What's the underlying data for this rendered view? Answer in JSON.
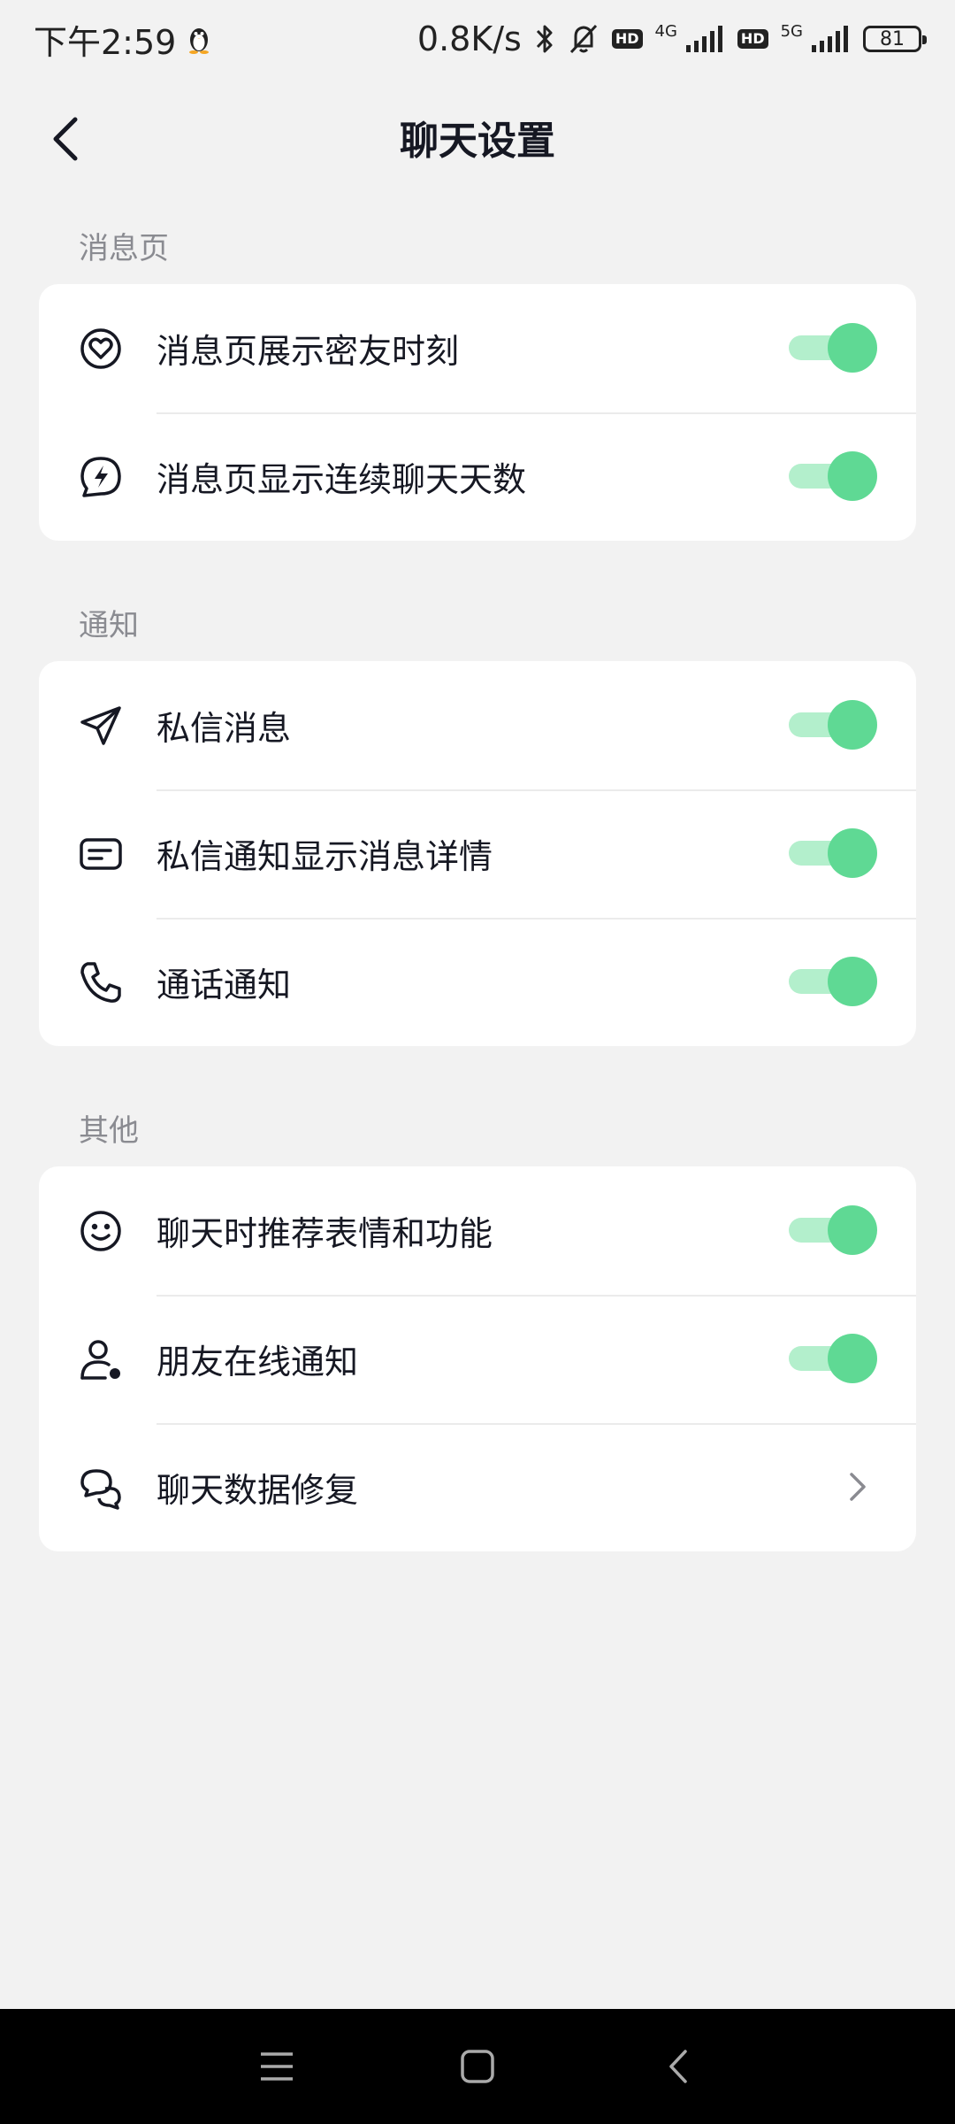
{
  "status_bar": {
    "time": "下午2:59",
    "net_speed": "0.8K/s",
    "hd1": "HD",
    "net1": "4G",
    "hd2": "HD",
    "net2": "5G",
    "battery": "81"
  },
  "header": {
    "title": "聊天设置"
  },
  "sections": [
    {
      "label": "消息页",
      "items": [
        {
          "label": "消息页展示密友时刻",
          "icon": "heart-circle-icon",
          "toggle": true
        },
        {
          "label": "消息页显示连续聊天天数",
          "icon": "lightning-chat-icon",
          "toggle": true
        }
      ]
    },
    {
      "label": "通知",
      "items": [
        {
          "label": "私信消息",
          "icon": "paper-plane-icon",
          "toggle": true
        },
        {
          "label": "私信通知显示消息详情",
          "icon": "message-card-icon",
          "toggle": true
        },
        {
          "label": "通话通知",
          "icon": "phone-icon",
          "toggle": true
        }
      ]
    },
    {
      "label": "其他",
      "items": [
        {
          "label": "聊天时推荐表情和功能",
          "icon": "smiley-icon",
          "toggle": true
        },
        {
          "label": "朋友在线通知",
          "icon": "user-online-icon",
          "toggle": true
        },
        {
          "label": "聊天数据修复",
          "icon": "chat-bubbles-icon",
          "chevron": true
        }
      ]
    }
  ],
  "colors": {
    "toggle_on_knob": "#5fd994",
    "toggle_on_track": "#b3efcc",
    "background": "#f2f2f2"
  }
}
